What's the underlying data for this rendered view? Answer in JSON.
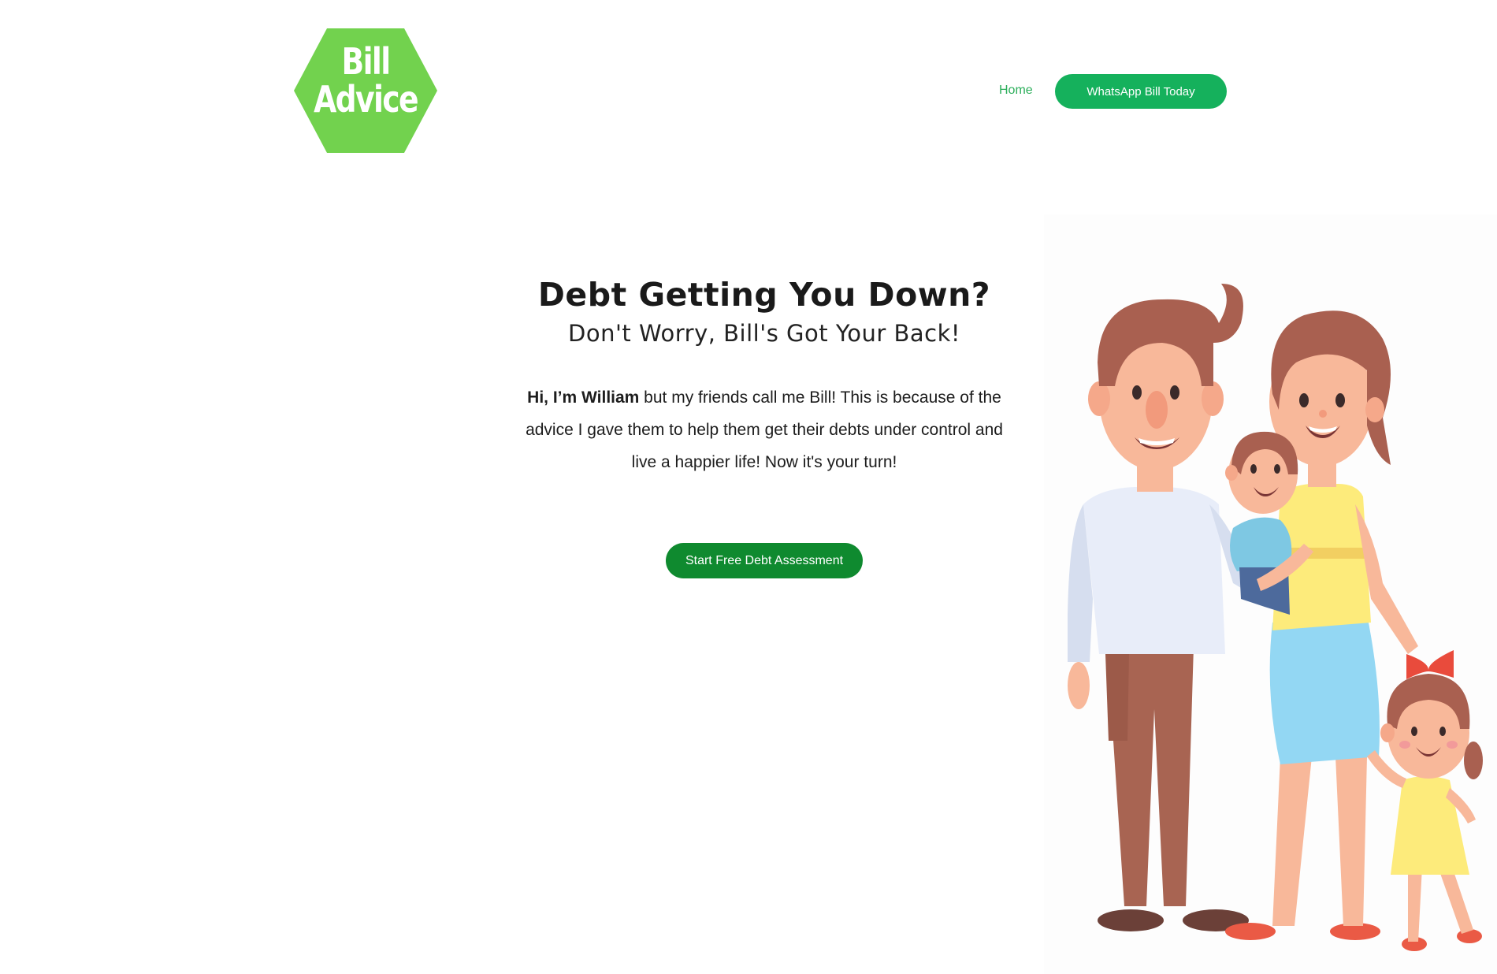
{
  "header": {
    "logo_line1": "Bill",
    "logo_line2": "Advice",
    "nav_home": "Home",
    "nav_cta": "WhatsApp Bill Today"
  },
  "hero": {
    "title": "Debt Getting You Down?",
    "subtitle": "Don't Worry, Bill's Got Your Back!",
    "intro_bold": "Hi, I’m William",
    "intro_rest": " but my friends call me Bill! This is because of the advice I gave them to help them get their debts under control and live a happier life! Now it's your turn!",
    "cta": "Start Free Debt Assessment"
  },
  "colors": {
    "logo_green": "#72d24e",
    "nav_green": "#2bae5a",
    "cta_green": "#15b15c",
    "hero_cta_green": "#0f8a2f"
  },
  "illustration": {
    "icon": "family-illustration"
  }
}
